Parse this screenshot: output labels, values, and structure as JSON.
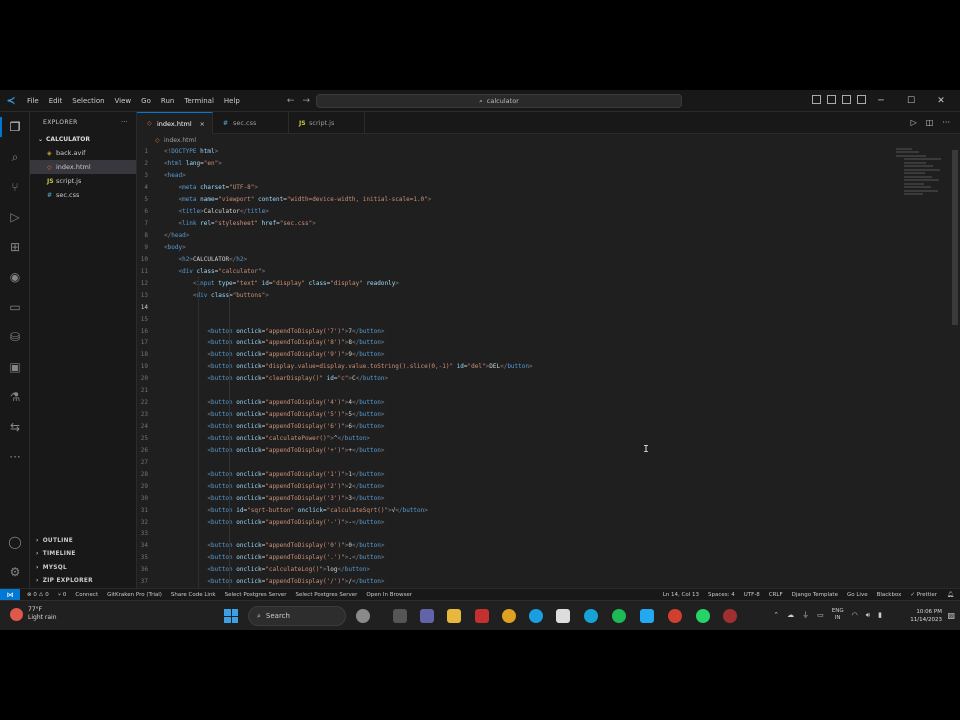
{
  "titlebar": {
    "menu": [
      "File",
      "Edit",
      "Selection",
      "View",
      "Go",
      "Run",
      "Terminal",
      "Help"
    ],
    "search": "calculator",
    "back_icon": "arrow-left-icon",
    "forward_icon": "arrow-right-icon"
  },
  "sidebar": {
    "title": "EXPLORER",
    "more": "···",
    "folder": "CALCULATOR",
    "files": [
      {
        "name": "back.avif",
        "icon": "dj"
      },
      {
        "name": "index.html",
        "icon": "html"
      },
      {
        "name": "script.js",
        "icon": "js"
      },
      {
        "name": "sec.css",
        "icon": "css"
      }
    ],
    "sections": [
      "OUTLINE",
      "TIMELINE",
      "MYSQL",
      "ZIP EXPLORER"
    ]
  },
  "tabs": [
    {
      "name": "index.html",
      "icon": "html",
      "active": true
    },
    {
      "name": "sec.css",
      "icon": "css",
      "active": false
    },
    {
      "name": "script.js",
      "icon": "js",
      "active": false
    }
  ],
  "breadcrumb": {
    "file": "index.html"
  },
  "code": {
    "lines": [
      {
        "no": "1",
        "text": "<!DOCTYPE html>"
      },
      {
        "no": "2",
        "text": "<html lang=\"en\">"
      },
      {
        "no": "3",
        "text": "<head>"
      },
      {
        "no": "4",
        "text": "    <meta charset=\"UTF-8\">"
      },
      {
        "no": "5",
        "text": "    <meta name=\"viewport\" content=\"width=device-width, initial-scale=1.0\">"
      },
      {
        "no": "6",
        "text": "    <title>Calculator</title>"
      },
      {
        "no": "7",
        "text": "    <link rel=\"stylesheet\" href=\"sec.css\">"
      },
      {
        "no": "8",
        "text": "</head>"
      },
      {
        "no": "9",
        "text": "<body>"
      },
      {
        "no": "10",
        "text": "    <h2>CALCULATOR</h2>"
      },
      {
        "no": "11",
        "text": "    <div class=\"calculator\">"
      },
      {
        "no": "12",
        "text": "        <input type=\"text\" id=\"display\" class=\"display\" readonly>"
      },
      {
        "no": "13",
        "text": "        <div class=\"buttons\">"
      },
      {
        "no": "14",
        "text": ""
      },
      {
        "no": "15",
        "text": ""
      },
      {
        "no": "16",
        "text": "            <button onclick=\"appendToDisplay('7')\">7</button>"
      },
      {
        "no": "17",
        "text": "            <button onclick=\"appendToDisplay('8')\">8</button>"
      },
      {
        "no": "18",
        "text": "            <button onclick=\"appendToDisplay('9')\">9</button>"
      },
      {
        "no": "19",
        "text": "            <button onclick=\"display.value=display.value.toString().slice(0,-1)\" id=\"del\">DEL</button>"
      },
      {
        "no": "20",
        "text": "            <button onclick=\"clearDisplay()\" id=\"c\">C</button>"
      },
      {
        "no": "21",
        "text": ""
      },
      {
        "no": "22",
        "text": "            <button onclick=\"appendToDisplay('4')\">4</button>"
      },
      {
        "no": "23",
        "text": "            <button onclick=\"appendToDisplay('5')\">5</button>"
      },
      {
        "no": "24",
        "text": "            <button onclick=\"appendToDisplay('6')\">6</button>"
      },
      {
        "no": "25",
        "text": "            <button onclick=\"calculatePower()\">^</button>"
      },
      {
        "no": "26",
        "text": "            <button onclick=\"appendToDisplay('+')\">+</button>"
      },
      {
        "no": "27",
        "text": ""
      },
      {
        "no": "28",
        "text": "            <button onclick=\"appendToDisplay('1')\">1</button>"
      },
      {
        "no": "29",
        "text": "            <button onclick=\"appendToDisplay('2')\">2</button>"
      },
      {
        "no": "30",
        "text": "            <button onclick=\"appendToDisplay('3')\">3</button>"
      },
      {
        "no": "31",
        "text": "            <button id=\"sqrt-button\" onclick=\"calculateSqrt()\">√</button>"
      },
      {
        "no": "32",
        "text": "            <button onclick=\"appendToDisplay('-')\">-</button>"
      },
      {
        "no": "33",
        "text": ""
      },
      {
        "no": "34",
        "text": "            <button onclick=\"appendToDisplay('0')\">0</button>"
      },
      {
        "no": "35",
        "text": "            <button onclick=\"appendToDisplay('.')\">.</button>"
      },
      {
        "no": "36",
        "text": "            <button onclick=\"calculateLog()\">log</button>"
      },
      {
        "no": "37",
        "text": "            <button onclick=\"appendToDisplay('/')\">/</button>"
      }
    ]
  },
  "statusbar": {
    "left": [
      "⊗ 0 ⚠ 0",
      "⑂ 0",
      "Connect",
      "GitKraken Pro (Trial)",
      "Share Code Link",
      "Select Postgres Server",
      "Select Postgres Server",
      "Open In Browser"
    ],
    "right": [
      "Ln 14, Col 13",
      "Spaces: 4",
      "UTF-8",
      "CRLF",
      "Django Template",
      "Go Live",
      "Blackbox",
      "✓ Prettier"
    ]
  },
  "taskbar": {
    "temp": "77°F",
    "condition": "Light rain",
    "search": "Search",
    "lang_top": "ENG",
    "lang_bottom": "IN",
    "time": "10:06 PM",
    "date": "11/14/2023"
  }
}
